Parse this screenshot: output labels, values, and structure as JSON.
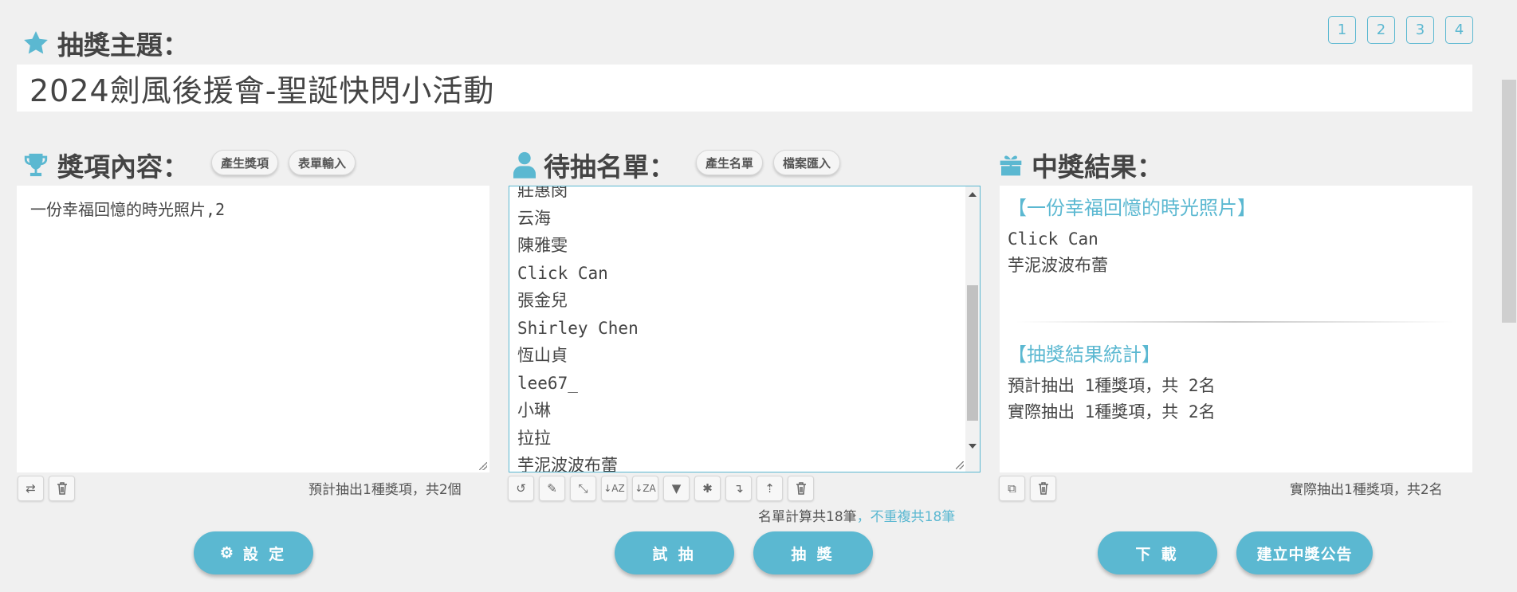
{
  "page_tabs": [
    "1",
    "2",
    "3",
    "4"
  ],
  "theme": {
    "label": "抽獎主題：",
    "value": "2024劍風後援會-聖誕快閃小活動"
  },
  "prizes": {
    "label": "獎項內容：",
    "generate_label": "產生獎項",
    "form_input_label": "表單輸入",
    "content": "一份幸福回憶的時光照片,2",
    "summary": "預計抽出1種獎項，共2個"
  },
  "names": {
    "label": "待抽名單：",
    "generate_label": "產生名單",
    "import_label": "檔案匯入",
    "list": [
      "莊惠閔",
      "云海",
      "陳雅雯",
      "Click Can",
      "張金兒",
      "Shirley Chen",
      "恆山貞",
      "lee67_",
      "小琳",
      "拉拉",
      "芋泥波波布蕾"
    ],
    "count_text": "名單計算共18筆",
    "unique_text": "，不重複共18筆"
  },
  "results": {
    "label": "中獎結果：",
    "prize_heading": "【一份幸福回憶的時光照片】",
    "winners": [
      "Click Can",
      "芋泥波波布蕾"
    ],
    "stats_heading": "【抽獎結果統計】",
    "expected": "預計抽出 1種獎項，共 2名",
    "actual": "實際抽出 1種獎項，共 2名",
    "summary": "實際抽出1種獎項，共2名"
  },
  "buttons": {
    "settings": "設 定",
    "trial": "試 抽",
    "draw": "抽 獎",
    "download": "下 載",
    "announce": "建立中獎公告"
  },
  "colors": {
    "accent": "#5bb8d1",
    "background": "#f0f0f0"
  }
}
